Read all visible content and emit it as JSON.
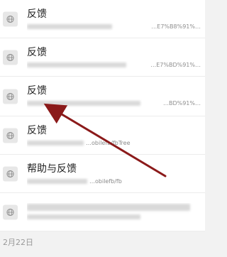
{
  "history_items": [
    {
      "title": "反馈",
      "url_visible": "…E7%B8%91%…"
    },
    {
      "title": "反馈",
      "url_visible": "…E7%BD%91%…"
    },
    {
      "title": "反馈",
      "url_visible": "…BD%91%…"
    },
    {
      "title": "反馈",
      "url_visible": "…obilefb/fbTree"
    },
    {
      "title": "帮助与反馈",
      "url_visible": "…obilefb/fb"
    },
    {
      "title": "",
      "url_visible": ""
    }
  ],
  "date_header": "2月22日",
  "icon_name": "globe-icon",
  "annotation_arrow_color": "#8b1a1a"
}
